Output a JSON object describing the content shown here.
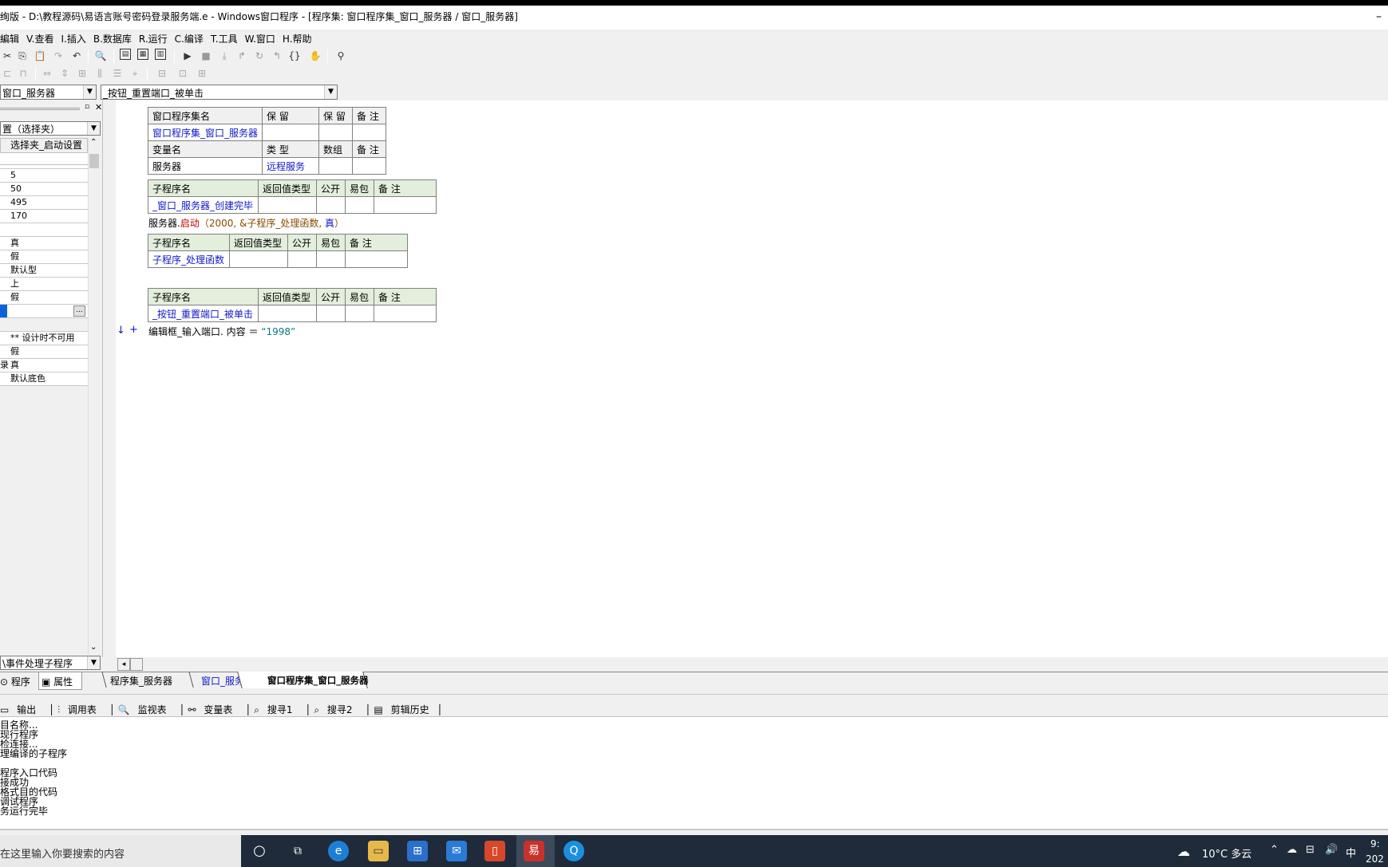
{
  "window": {
    "title": "绚版 - D:\\教程源码\\易语言账号密码登录服务端.e - Windows窗口程序 - [程序集: 窗口程序集_窗口_服务器 / 窗口_服务器]",
    "minimize": "–"
  },
  "menu": [
    "編辑",
    "V.查看",
    "I.插入",
    "B.数据库",
    "R.运行",
    "C.编译",
    "T.工具",
    "W.窗口",
    "H.帮助"
  ],
  "combos": {
    "left": "窗口_服务器",
    "right": "_按钮_重置端口_被单击",
    "prop_combo": "置（选择夹）"
  },
  "props": {
    "header": "选择夹_启动设置",
    "rows": [
      "",
      "5",
      "50",
      "495",
      "170",
      "",
      "真",
      "假",
      "默认型",
      "上",
      "假",
      "",
      "",
      "** 设计时不可用",
      "假",
      "真",
      "默认底色"
    ],
    "row_prefix_ed": "录",
    "ellipsis": "..."
  },
  "left_bottom": {
    "event_combo": "\\事件处理子程序",
    "tab_program": "程序",
    "tab_props": "属性"
  },
  "code": {
    "assembly_table": {
      "headers": [
        "窗口程序集名",
        "保 留",
        "保 留",
        "备 注"
      ],
      "name": "窗口程序集_窗口_服务器"
    },
    "var_table": {
      "headers": [
        "变量名",
        "类 型",
        "数组",
        "备 注"
      ],
      "name": "服务器",
      "type": "远程服务"
    },
    "sub1": {
      "headers": [
        "子程序名",
        "返回值类型",
        "公开",
        "易包",
        "备 注"
      ],
      "name": "_窗口_服务器_创建完毕"
    },
    "line1": {
      "obj": "服务器.",
      "method": "启动",
      "args": "（2000, &子程序_处理函数, ",
      "kw": "真",
      "close": "）"
    },
    "sub2": {
      "headers": [
        "子程序名",
        "返回值类型",
        "公开",
        "易包",
        "备 注"
      ],
      "name": "子程序_处理函数"
    },
    "sub3": {
      "headers": [
        "子程序名",
        "返回值类型",
        "公开",
        "易包",
        "备 注"
      ],
      "name": "_按钮_重置端口_被单击"
    },
    "line2": {
      "arrow": "↓",
      "plus": "+",
      "text": "编辑框_输入端口. 内容 ＝ ",
      "value": "“1998”"
    }
  },
  "doc_tabs": [
    "程序集_服务器",
    "窗口_服务器",
    "窗口程序集_窗口_服务器"
  ],
  "bottom_tabs": [
    "输出",
    "调用表",
    "监视表",
    "变量表",
    "搜寻1",
    "搜寻2",
    "剪辑历史"
  ],
  "output_lines": [
    "目名称...",
    "现行程序",
    "检连接...",
    "理编译的子程序",
    "",
    "程序入口代码",
    "接成功",
    "格式目的代码",
    "调试程序",
    "务运行完毕"
  ],
  "taskbar": {
    "search_placeholder": "在这里输入你要搜索的内容",
    "weather": "10°C 多云",
    "ime": "中",
    "time": "9:",
    "date": "202"
  }
}
